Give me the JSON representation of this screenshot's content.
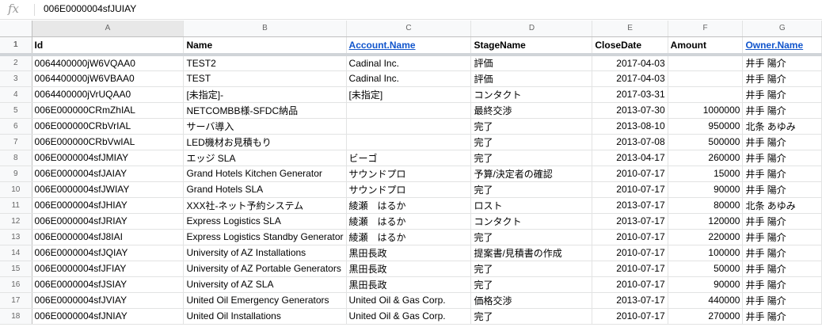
{
  "formula_bar": {
    "fx_label": "fx",
    "value": "006E0000004sfJUIAY"
  },
  "columns": [
    "A",
    "B",
    "C",
    "D",
    "E",
    "F",
    "G"
  ],
  "header": [
    "Id",
    "Name",
    "Account.Name",
    "StageName",
    "CloseDate",
    "Amount",
    "Owner.Name"
  ],
  "rows": [
    {
      "n": "2",
      "c": [
        "0064400000jW6VQAA0",
        "TEST2",
        "Cadinal Inc.",
        "評価",
        "2017-04-03",
        "",
        "井手 陽介"
      ]
    },
    {
      "n": "3",
      "c": [
        "0064400000jW6VBAA0",
        "TEST",
        "Cadinal Inc.",
        "評価",
        "2017-04-03",
        "",
        "井手 陽介"
      ]
    },
    {
      "n": "4",
      "c": [
        "0064400000jVrUQAA0",
        "[未指定]-",
        "[未指定]",
        "コンタクト",
        "2017-03-31",
        "",
        "井手 陽介"
      ]
    },
    {
      "n": "5",
      "c": [
        "006E000000CRmZhIAL",
        "NETCOMBB様-SFDC納品",
        "",
        "最終交渉",
        "2013-07-30",
        "1000000",
        "井手 陽介"
      ]
    },
    {
      "n": "6",
      "c": [
        "006E000000CRbVrIAL",
        "サーバ導入",
        "",
        "完了",
        "2013-08-10",
        "950000",
        "北条 あゆみ"
      ]
    },
    {
      "n": "7",
      "c": [
        "006E000000CRbVwIAL",
        "LED機材お見積もり",
        "",
        "完了",
        "2013-07-08",
        "500000",
        "井手 陽介"
      ]
    },
    {
      "n": "8",
      "c": [
        "006E0000004sfJMIAY",
        "エッジ SLA",
        "ビーゴ",
        "完了",
        "2013-04-17",
        "260000",
        "井手 陽介"
      ]
    },
    {
      "n": "9",
      "c": [
        "006E0000004sfJAIAY",
        "Grand Hotels Kitchen Generator",
        "サウンドプロ",
        "予算/決定者の確認",
        "2010-07-17",
        "15000",
        "井手 陽介"
      ]
    },
    {
      "n": "10",
      "c": [
        "006E0000004sfJWIAY",
        "Grand Hotels SLA",
        "サウンドプロ",
        "完了",
        "2010-07-17",
        "90000",
        "井手 陽介"
      ]
    },
    {
      "n": "11",
      "c": [
        "006E0000004sfJHIAY",
        "XXX社-ネット予約システム",
        "綾瀬　はるか",
        "ロスト",
        "2013-07-17",
        "80000",
        "北条 あゆみ"
      ]
    },
    {
      "n": "12",
      "c": [
        "006E0000004sfJRIAY",
        "Express Logistics SLA",
        "綾瀬　はるか",
        "コンタクト",
        "2013-07-17",
        "120000",
        "井手 陽介"
      ]
    },
    {
      "n": "13",
      "c": [
        "006E0000004sfJ8IAI",
        "Express Logistics Standby Generator",
        "綾瀬　はるか",
        "完了",
        "2010-07-17",
        "220000",
        "井手 陽介"
      ]
    },
    {
      "n": "14",
      "c": [
        "006E0000004sfJQIAY",
        "University of AZ Installations",
        "黒田長政",
        "提案書/見積書の作成",
        "2010-07-17",
        "100000",
        "井手 陽介"
      ]
    },
    {
      "n": "15",
      "c": [
        "006E0000004sfJFIAY",
        "University of AZ Portable Generators",
        "黒田長政",
        "完了",
        "2010-07-17",
        "50000",
        "井手 陽介"
      ]
    },
    {
      "n": "16",
      "c": [
        "006E0000004sfJSIAY",
        "University of AZ SLA",
        "黒田長政",
        "完了",
        "2010-07-17",
        "90000",
        "井手 陽介"
      ]
    },
    {
      "n": "17",
      "c": [
        "006E0000004sfJVIAY",
        "United Oil Emergency Generators",
        "United Oil & Gas Corp.",
        "価格交渉",
        "2013-07-17",
        "440000",
        "井手 陽介"
      ]
    },
    {
      "n": "18",
      "c": [
        "006E0000004sfJNIAY",
        "United Oil Installations",
        "United Oil & Gas Corp.",
        "完了",
        "2010-07-17",
        "270000",
        "井手 陽介"
      ]
    }
  ],
  "colors": {
    "link": "#1155cc",
    "header_bg": "#f8f9fa",
    "grid": "#e2e3e3"
  }
}
